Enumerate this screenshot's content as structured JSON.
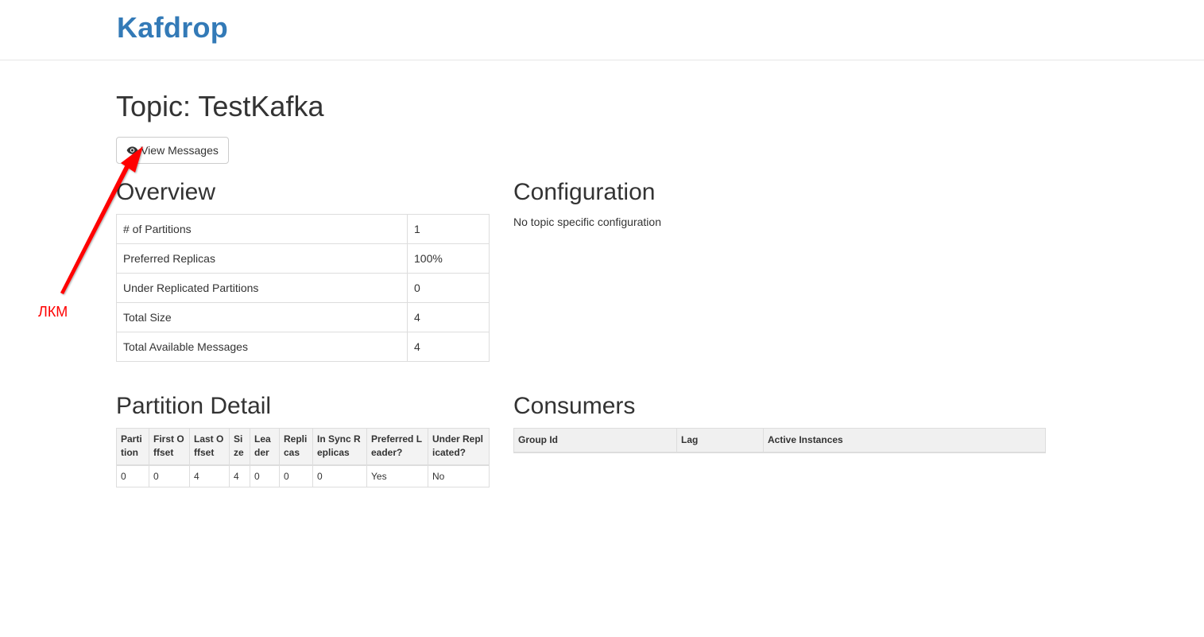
{
  "brand": "Kafdrop",
  "page_title": "Topic: TestKafka",
  "view_messages_button": {
    "label": "View Messages",
    "icon": "eye-icon"
  },
  "overview": {
    "heading": "Overview",
    "rows": [
      {
        "label": "# of Partitions",
        "value": "1"
      },
      {
        "label": "Preferred Replicas",
        "value": "100%"
      },
      {
        "label": "Under Replicated Partitions",
        "value": "0"
      },
      {
        "label": "Total Size",
        "value": "4"
      },
      {
        "label": "Total Available Messages",
        "value": "4"
      }
    ]
  },
  "configuration": {
    "heading": "Configuration",
    "text": "No topic specific configuration"
  },
  "partition_detail": {
    "heading": "Partition Detail",
    "columns": [
      "Partition",
      "First Offset",
      "Last Offset",
      "Size",
      "Leader",
      "Replicas",
      "In Sync Replicas",
      "Preferred Leader?",
      "Under Replicated?"
    ],
    "rows": [
      [
        "0",
        "0",
        "4",
        "4",
        "0",
        "0",
        "0",
        "Yes",
        "No"
      ]
    ]
  },
  "consumers": {
    "heading": "Consumers",
    "columns": [
      "Group Id",
      "Lag",
      "Active Instances"
    ]
  },
  "annotation": {
    "text": "ЛКМ",
    "color": "#ff0000"
  },
  "colors": {
    "brand": "#337ab7",
    "border": "#dddddd"
  }
}
